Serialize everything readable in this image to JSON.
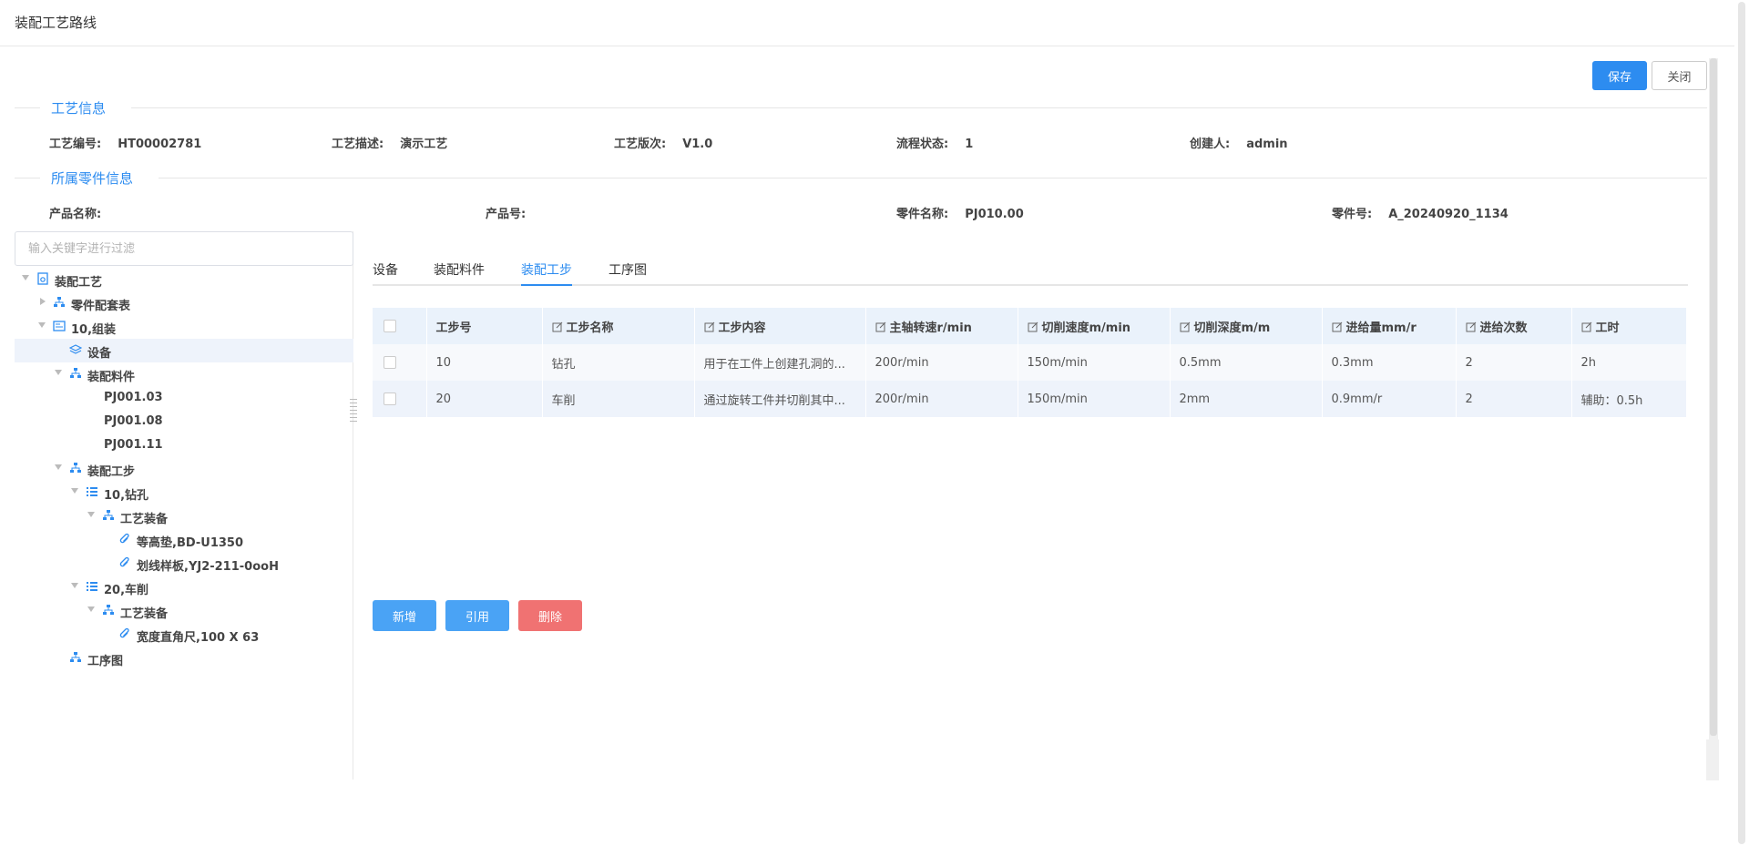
{
  "header": {
    "title": "装配工艺路线"
  },
  "toolbar": {
    "save_label": "保存",
    "close_label": "关闭"
  },
  "process_info": {
    "section_title": "工艺信息",
    "fields": [
      {
        "label": "工艺编号:",
        "value": "HT00002781"
      },
      {
        "label": "工艺描述:",
        "value": "演示工艺"
      },
      {
        "label": "工艺版次:",
        "value": "V1.0"
      },
      {
        "label": "流程状态:",
        "value": "1"
      },
      {
        "label": "创建人:",
        "value": "admin"
      }
    ]
  },
  "part_info": {
    "section_title": "所属零件信息",
    "fields": [
      {
        "label": "产品名称:",
        "value": ""
      },
      {
        "label": "产品号:",
        "value": ""
      },
      {
        "label": "零件名称:",
        "value": "PJ010.00"
      },
      {
        "label": "零件号:",
        "value": "A_20240920_1134"
      }
    ]
  },
  "tree": {
    "filter_placeholder": "输入关键字进行过滤",
    "nodes": [
      {
        "label": "装配工艺",
        "icon": "document-icon"
      },
      {
        "label": "零件配套表",
        "icon": "org-chart-icon"
      },
      {
        "label": "10,组装",
        "icon": "process-icon"
      },
      {
        "label": "设备",
        "icon": "layers-icon"
      },
      {
        "label": "装配料件",
        "icon": "org-chart-icon"
      },
      {
        "label": "PJ001.03",
        "icon": ""
      },
      {
        "label": "PJ001.08",
        "icon": ""
      },
      {
        "label": "PJ001.11",
        "icon": ""
      },
      {
        "label": "装配工步",
        "icon": "org-chart-icon"
      },
      {
        "label": "10,钻孔",
        "icon": "list-icon"
      },
      {
        "label": "工艺装备",
        "icon": "org-chart-icon"
      },
      {
        "label": "等高垫,BD-U1350",
        "icon": "paperclip-icon"
      },
      {
        "label": "划线样板,YJ2-211-0ooH",
        "icon": "paperclip-icon"
      },
      {
        "label": "20,车削",
        "icon": "list-icon"
      },
      {
        "label": "工艺装备",
        "icon": "org-chart-icon"
      },
      {
        "label": "宽度直角尺,100 X 63",
        "icon": "paperclip-icon"
      },
      {
        "label": "工序图",
        "icon": "org-chart-icon"
      }
    ]
  },
  "tabs": [
    {
      "label": "设备"
    },
    {
      "label": "装配料件"
    },
    {
      "label": "装配工步"
    },
    {
      "label": "工序图"
    }
  ],
  "active_tab": "装配工步",
  "table": {
    "columns": [
      "工步号",
      "工步名称",
      "工步内容",
      "主轴转速r/min",
      "切削速度m/min",
      "切削深度m/m",
      "进给量mm/r",
      "进给次数",
      "工时"
    ],
    "rows": [
      [
        "10",
        "钻孔",
        "用于在工件上创建孔洞的...",
        "200r/min",
        "150m/min",
        "0.5mm",
        "0.3mm",
        "2",
        "2h"
      ],
      [
        "20",
        "车削",
        "通过旋转工件并切削其中...",
        "200r/min",
        "150m/min",
        "2mm",
        "0.9mm/r",
        "2",
        "辅助：0.5h"
      ]
    ]
  },
  "actions": {
    "add_label": "新增",
    "cite_label": "引用",
    "delete_label": "删除"
  },
  "colors": {
    "primary": "#2d8cf0",
    "danger": "#f07272",
    "action_blue": "#4aa3f5"
  }
}
